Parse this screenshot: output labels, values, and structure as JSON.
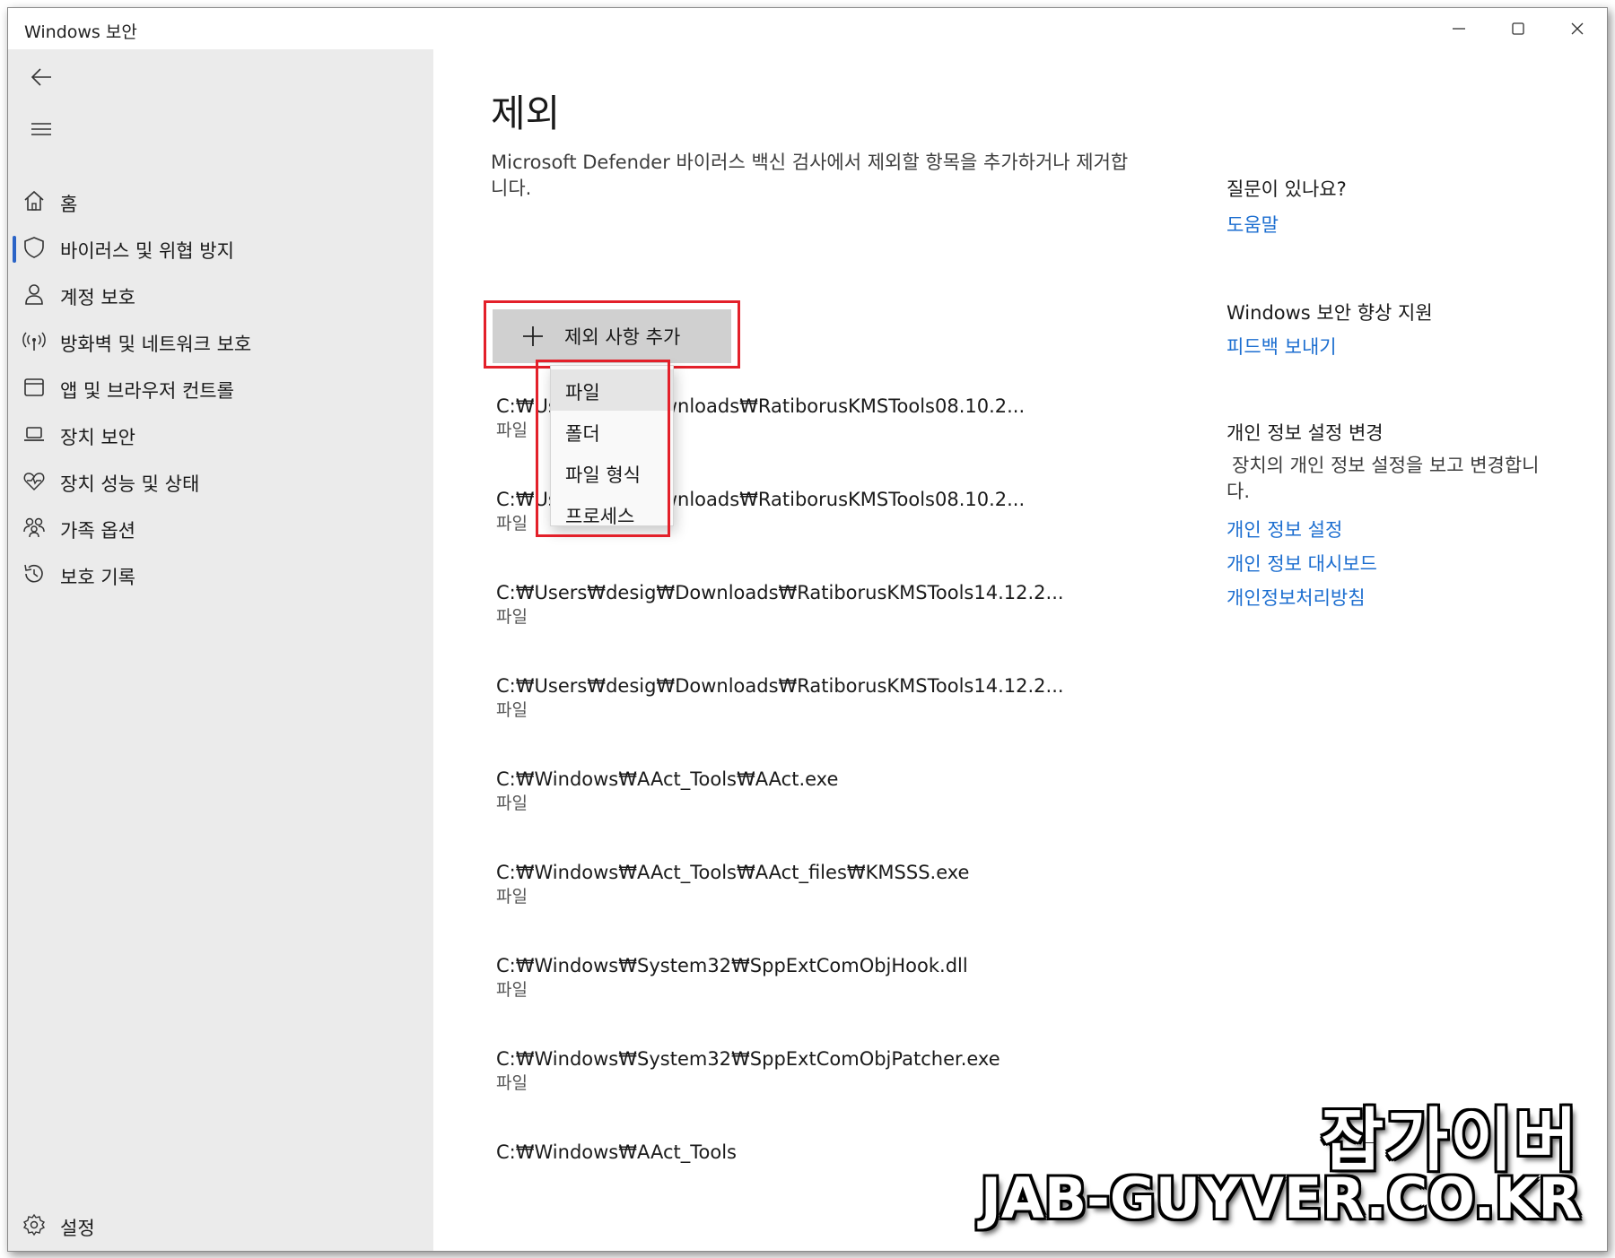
{
  "window": {
    "title": "Windows 보안"
  },
  "sidebar": {
    "items": [
      {
        "label": "홈",
        "icon": "home-icon"
      },
      {
        "label": "바이러스 및 위협 방지",
        "icon": "shield-icon",
        "active": true
      },
      {
        "label": "계정 보호",
        "icon": "person-icon"
      },
      {
        "label": "방화벽 및 네트워크 보호",
        "icon": "antenna-icon"
      },
      {
        "label": "앱 및 브라우저 컨트롤",
        "icon": "browser-window-icon"
      },
      {
        "label": "장치 보안",
        "icon": "laptop-icon"
      },
      {
        "label": "장치 성능 및 상태",
        "icon": "heart-pulse-icon"
      },
      {
        "label": "가족 옵션",
        "icon": "family-icon"
      },
      {
        "label": "보호 기록",
        "icon": "history-icon"
      }
    ],
    "settings_label": "설정"
  },
  "main": {
    "title": "제외",
    "description": "Microsoft Defender 바이러스 백신 검사에서 제외할 항목을 추가하거나 제거합니다.",
    "add_button_label": "제외 사항 추가",
    "dropdown": [
      "파일",
      "폴더",
      "파일 형식",
      "프로세스"
    ],
    "exclusions": [
      {
        "path": "C:₩Us",
        "path_tail": "wnloads₩RatiborusKMSTools08.10.2...",
        "type": "파일"
      },
      {
        "path": "C:₩Us",
        "path_tail": "wnloads₩RatiborusKMSTools08.10.2...",
        "type": "파일"
      },
      {
        "path": "C:₩Users₩desig₩Downloads₩RatiborusKMSTools14.12.2...",
        "type": "파일"
      },
      {
        "path": "C:₩Users₩desig₩Downloads₩RatiborusKMSTools14.12.2...",
        "type": "파일"
      },
      {
        "path": "C:₩Windows₩AAct_Tools₩AAct.exe",
        "type": "파일"
      },
      {
        "path": "C:₩Windows₩AAct_Tools₩AAct_files₩KMSSS.exe",
        "type": "파일"
      },
      {
        "path": "C:₩Windows₩System32₩SppExtComObjHook.dll",
        "type": "파일"
      },
      {
        "path": "C:₩Windows₩System32₩SppExtComObjPatcher.exe",
        "type": "파일"
      },
      {
        "path": "C:₩Windows₩AAct_Tools",
        "type": ""
      }
    ]
  },
  "right_panel": {
    "question_heading": "질문이 있나요?",
    "help_link": "도움말",
    "improve_heading": "Windows 보안 향상 지원",
    "feedback_link": "피드백 보내기",
    "privacy_heading": "개인 정보 설정 변경",
    "privacy_text": "장치의 개인 정보 설정을 보고 변경합니다.",
    "privacy_links": [
      "개인 정보 설정",
      "개인 정보 대시보드",
      "개인정보처리방침"
    ]
  },
  "watermark": {
    "korean": "잡가이버",
    "english": "JAB-GUYVER.CO.KR"
  },
  "colors": {
    "sidebar_bg": "#ebebeb",
    "accent": "#2b64c7",
    "link": "#1c6ed0",
    "highlight": "#e3202a",
    "button_bg": "#d0d0d0"
  }
}
